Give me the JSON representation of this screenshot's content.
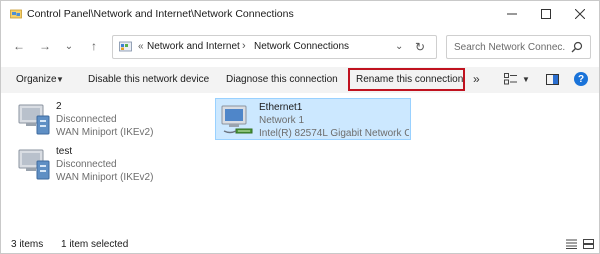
{
  "window": {
    "title": "Control Panel\\Network and Internet\\Network Connections",
    "controls": {
      "minimize": "—",
      "maximize": "☐",
      "close": "✕"
    }
  },
  "nav": {
    "back": "←",
    "forward": "→",
    "recent": "⌄",
    "up": "↑",
    "address": {
      "overflow": "«",
      "segments": [
        "Network and Internet",
        "Network Connections"
      ],
      "separator": "›",
      "dropdown": "⌄",
      "refresh": "↻"
    },
    "search": {
      "placeholder": "Search Network Connec..."
    }
  },
  "commandbar": {
    "organize": "Organize",
    "disable": "Disable this network device",
    "diagnose": "Diagnose this connection",
    "rename": "Rename this connection",
    "more": "»",
    "help": "?",
    "highlight_color": "#c0121f"
  },
  "connections": [
    {
      "name": "2",
      "status": "Disconnected",
      "device": "WAN Miniport (IKEv2)",
      "selected": false,
      "icon": "wan-adapter-icon"
    },
    {
      "name": "Ethernet1",
      "status": "Network 1",
      "device": "Intel(R) 82574L Gigabit Network C...",
      "selected": true,
      "icon": "ethernet-adapter-icon"
    },
    {
      "name": "test",
      "status": "Disconnected",
      "device": "WAN Miniport (IKEv2)",
      "selected": false,
      "icon": "wan-adapter-icon"
    }
  ],
  "statusbar": {
    "count": "3 items",
    "selection": "1 item selected"
  },
  "colors": {
    "selection_bg": "#cce8ff",
    "selection_border": "#99d1ff",
    "accent": "#1a73d9"
  }
}
